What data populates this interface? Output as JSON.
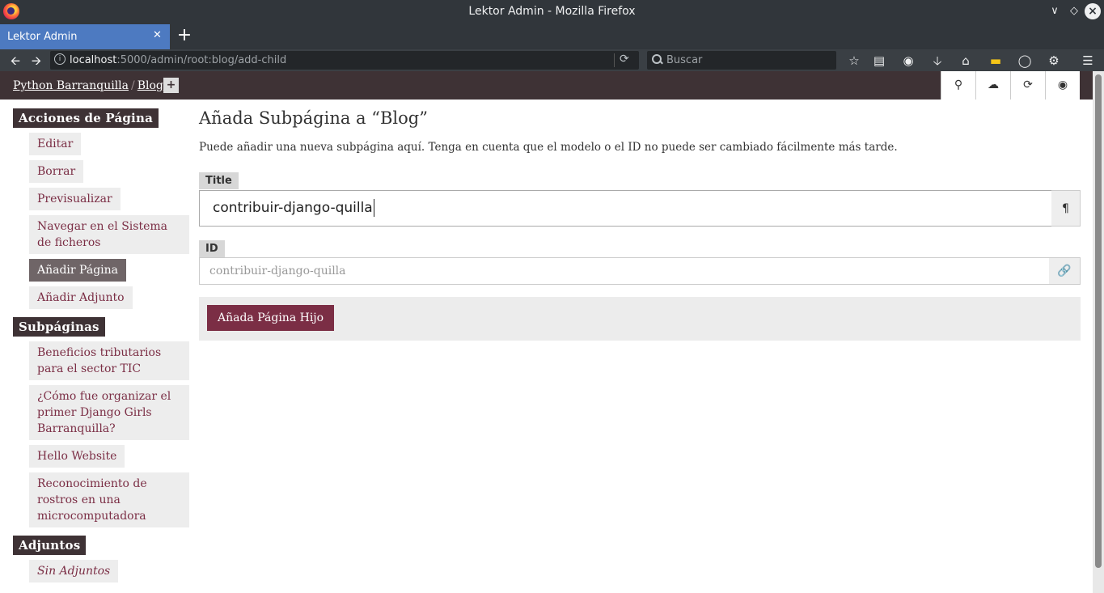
{
  "window": {
    "title": "Lektor Admin - Mozilla Firefox"
  },
  "tab": {
    "label": "Lektor Admin"
  },
  "urlbar": {
    "host": "localhost",
    "rest": ":5000/admin/root:blog/add-child"
  },
  "search": {
    "placeholder": "Buscar"
  },
  "breadcrumb": {
    "items": [
      "Python Barranquilla",
      "Blog"
    ],
    "add": "+"
  },
  "sidebar": {
    "page_actions": {
      "title": "Acciones de Página",
      "items": [
        "Editar",
        "Borrar",
        "Previsualizar",
        "Navegar en el Sistema de ficheros",
        "Añadir Página",
        "Añadir Adjunto"
      ],
      "active": "Añadir Página"
    },
    "subpages": {
      "title": "Subpáginas",
      "items": [
        "Beneficios tributarios para el sector TIC",
        "¿Cómo fue organizar el primer Django Girls Barranquilla?",
        "Hello Website",
        "Reconocimiento de rostros en una microcomputadora"
      ]
    },
    "attachments": {
      "title": "Adjuntos",
      "empty": "Sin Adjuntos"
    }
  },
  "main": {
    "title": "Añada Subpágina a “Blog”",
    "help": "Puede añadir una nueva subpágina aquí. Tenga en cuenta que el modelo o el ID no puede ser cambiado fácilmente más tarde.",
    "title_label": "Title",
    "title_value": "contribuir-django-quilla",
    "id_label": "ID",
    "id_placeholder": "contribuir-django-quilla",
    "submit": "Añada Página Hijo"
  },
  "colors": {
    "accent": "#7b2e45",
    "header_bg": "#3e3235",
    "active_bg": "#6f6567"
  }
}
